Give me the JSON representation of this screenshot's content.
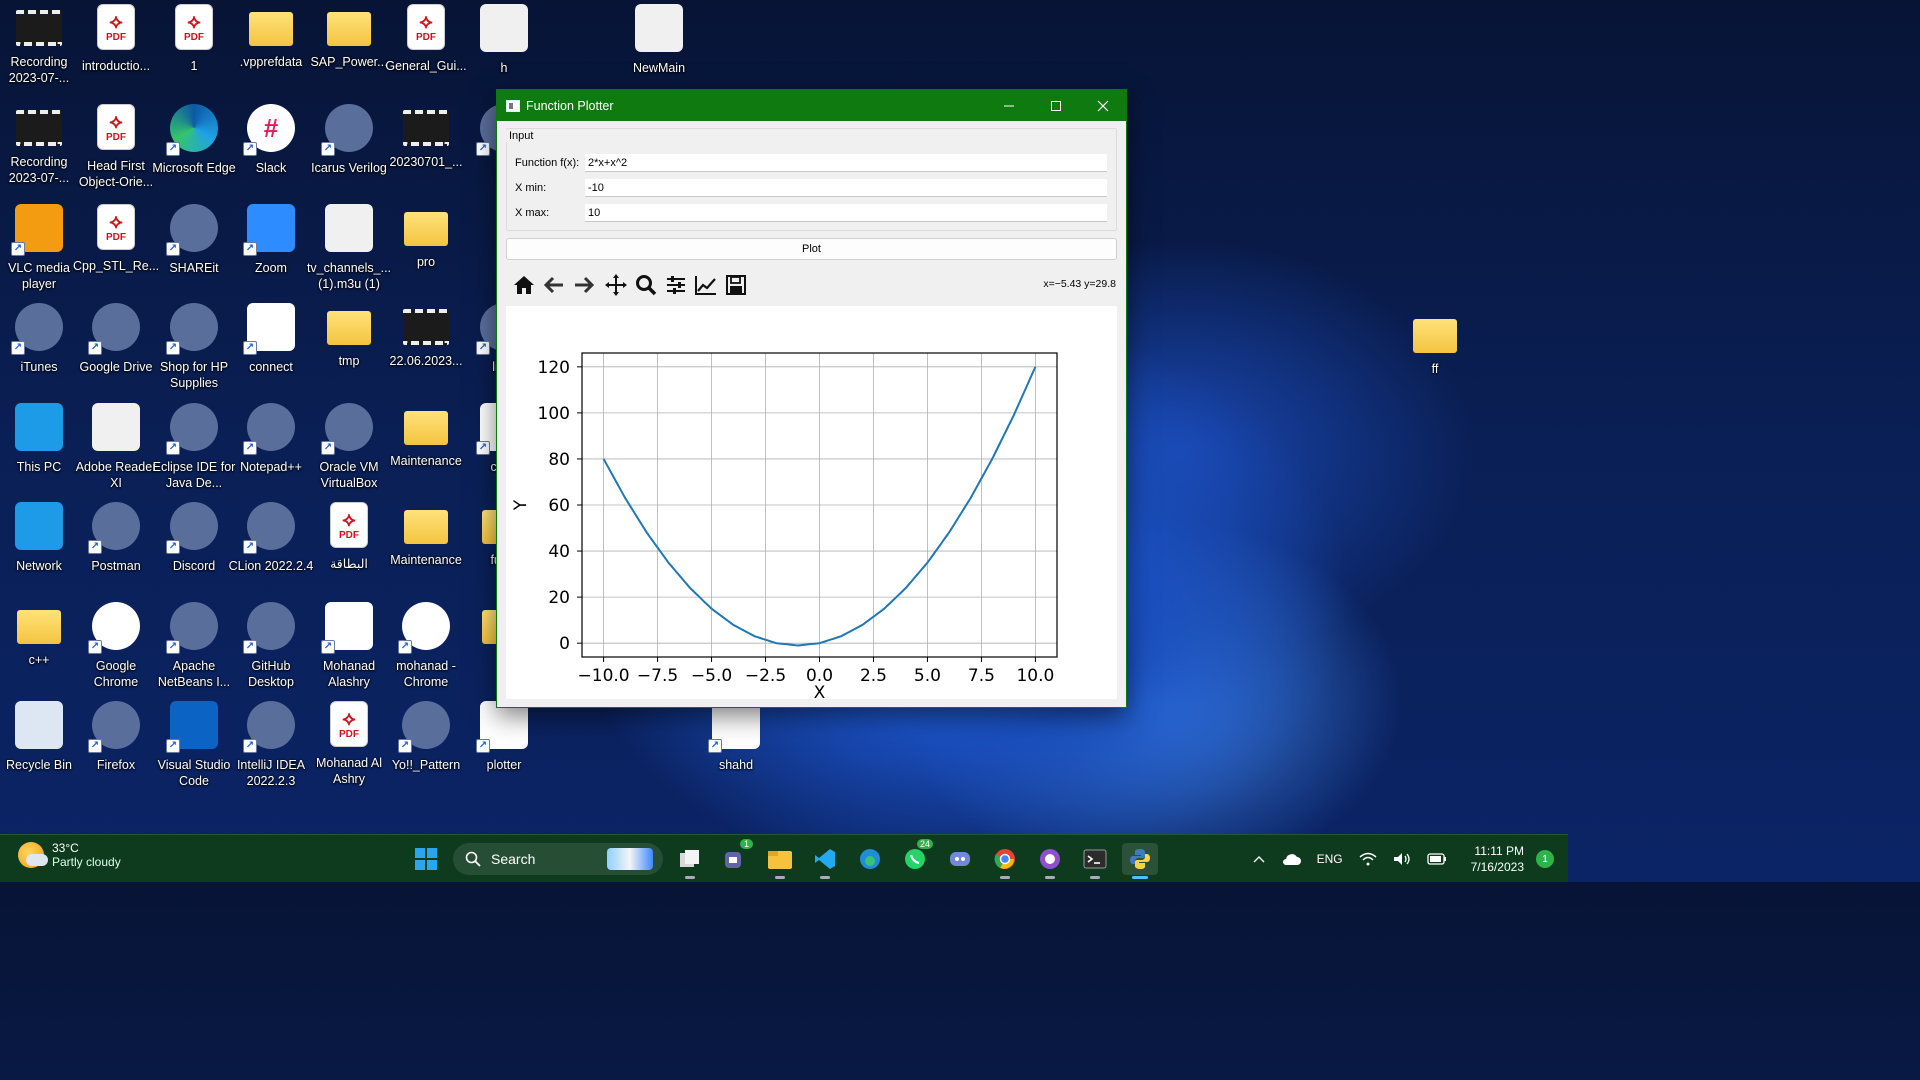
{
  "desktop": {
    "icons": [
      {
        "label": "Recording 2023-07-...",
        "type": "video"
      },
      {
        "label": "introductio...",
        "type": "pdf"
      },
      {
        "label": "1",
        "type": "pdf"
      },
      {
        "label": ".vpprefdata",
        "type": "folder"
      },
      {
        "label": "SAP_Power...",
        "type": "folder"
      },
      {
        "label": "General_Gui...",
        "type": "pdf"
      },
      {
        "label": "h",
        "type": "file"
      },
      {
        "label": "NewMain",
        "type": "file"
      },
      {
        "label": "Recording 2023-07-...",
        "type": "video"
      },
      {
        "label": "Head First Object-Orie...",
        "type": "pdf"
      },
      {
        "label": "Microsoft Edge",
        "type": "edge"
      },
      {
        "label": "Slack",
        "type": "slack"
      },
      {
        "label": "Icarus Verilog",
        "type": "app"
      },
      {
        "label": "20230701_...",
        "type": "video"
      },
      {
        "label": "Ac",
        "type": "app"
      },
      {
        "label": "VLC media player",
        "type": "vlc"
      },
      {
        "label": "Cpp_STL_Re...",
        "type": "pdf"
      },
      {
        "label": "SHAREit",
        "type": "app"
      },
      {
        "label": "Zoom",
        "type": "zoom"
      },
      {
        "label": "tv_channels_... (1).m3u (1)",
        "type": "file"
      },
      {
        "label": "pro",
        "type": "folder"
      },
      {
        "label": "iTunes",
        "type": "app"
      },
      {
        "label": "Google Drive",
        "type": "app"
      },
      {
        "label": "Shop for HP Supplies",
        "type": "app"
      },
      {
        "label": "connect",
        "type": "python"
      },
      {
        "label": "tmp",
        "type": "folder"
      },
      {
        "label": "22.06.2023...",
        "type": "video"
      },
      {
        "label": "liber",
        "type": "app"
      },
      {
        "label": "This PC",
        "type": "pc"
      },
      {
        "label": "Adobe Reader XI",
        "type": "file"
      },
      {
        "label": "Eclipse IDE for Java De...",
        "type": "app"
      },
      {
        "label": "Notepad++",
        "type": "app"
      },
      {
        "label": "Oracle VM VirtualBox",
        "type": "app"
      },
      {
        "label": "Maintenance",
        "type": "folder"
      },
      {
        "label": "conn",
        "type": "python"
      },
      {
        "label": "Network",
        "type": "pc"
      },
      {
        "label": "Postman",
        "type": "app"
      },
      {
        "label": "Discord",
        "type": "app"
      },
      {
        "label": "CLion 2022.2.4",
        "type": "app"
      },
      {
        "label": "البطاقة",
        "type": "pdf"
      },
      {
        "label": "Maintenance",
        "type": "folder"
      },
      {
        "label": "funct",
        "type": "folder"
      },
      {
        "label": "c++",
        "type": "folder"
      },
      {
        "label": "Google Chrome",
        "type": "chrome"
      },
      {
        "label": "Apache NetBeans I...",
        "type": "app"
      },
      {
        "label": "GitHub Desktop",
        "type": "app"
      },
      {
        "label": "Mohanad Alashry",
        "type": "word"
      },
      {
        "label": "mohanad - Chrome",
        "type": "chrome"
      },
      {
        "label": "Pr",
        "type": "folder"
      },
      {
        "label": "Recycle Bin",
        "type": "bin"
      },
      {
        "label": "Firefox",
        "type": "app"
      },
      {
        "label": "Visual Studio Code",
        "type": "vscode"
      },
      {
        "label": "IntelliJ IDEA 2022.2.3",
        "type": "app"
      },
      {
        "label": "Mohanad Al Ashry",
        "type": "pdf"
      },
      {
        "label": "Yo!!_Pattern",
        "type": "app"
      },
      {
        "label": "plotter",
        "type": "python"
      },
      {
        "label": "shahd",
        "type": "python"
      },
      {
        "label": "ff",
        "type": "folder"
      }
    ],
    "pdf_badge": "PDF"
  },
  "window": {
    "title": "Function Plotter",
    "group_title": "Input",
    "function_label": "Function f(x):",
    "function_value": "2*x+x^2",
    "xmin_label": "X min:",
    "xmin_value": "-10",
    "xmax_label": "X max:",
    "xmax_value": "10",
    "plot_button": "Plot",
    "coords_readout": "x=−5.43 y=29.8"
  },
  "chart_data": {
    "type": "line",
    "function": "2*x+x^2",
    "xlabel": "X",
    "ylabel": "Y",
    "xlim": [
      -11.0,
      11.0
    ],
    "ylim": [
      -6,
      126
    ],
    "xticks": [
      "−10.0",
      "−7.5",
      "−5.0",
      "−2.5",
      "0.0",
      "2.5",
      "5.0",
      "7.5",
      "10.0"
    ],
    "yticks": [
      "0",
      "20",
      "40",
      "60",
      "80",
      "100",
      "120"
    ],
    "grid": true,
    "line_color": "#1f77b4",
    "series": [
      {
        "x": [
          -10,
          -9,
          -8,
          -7,
          -6,
          -5,
          -4,
          -3,
          -2,
          -1,
          0,
          1,
          2,
          3,
          4,
          5,
          6,
          7,
          8,
          9,
          10
        ],
        "values": [
          80,
          63,
          48,
          35,
          24,
          15,
          8,
          3,
          0,
          -1,
          0,
          3,
          8,
          15,
          24,
          35,
          48,
          63,
          80,
          99,
          120
        ]
      }
    ]
  },
  "taskbar": {
    "weather_temp": "33°C",
    "weather_desc": "Partly cloudy",
    "search_label": "Search",
    "apps": [
      {
        "name": "start"
      },
      {
        "name": "search"
      },
      {
        "name": "widgets"
      },
      {
        "name": "task-view"
      },
      {
        "name": "teams",
        "badge": "1"
      },
      {
        "name": "file-explorer"
      },
      {
        "name": "vscode"
      },
      {
        "name": "edge"
      },
      {
        "name": "whatsapp",
        "badge": "24"
      },
      {
        "name": "discord"
      },
      {
        "name": "chrome"
      },
      {
        "name": "github-desktop"
      },
      {
        "name": "terminal"
      },
      {
        "name": "python"
      }
    ],
    "language": "ENG",
    "time": "11:11 PM",
    "date": "7/16/2023",
    "notification_count": "1"
  },
  "colors": {
    "titlebar": "#0f7a0f",
    "taskbar": "#0e3a1e",
    "plot_line": "#1f77b4"
  }
}
